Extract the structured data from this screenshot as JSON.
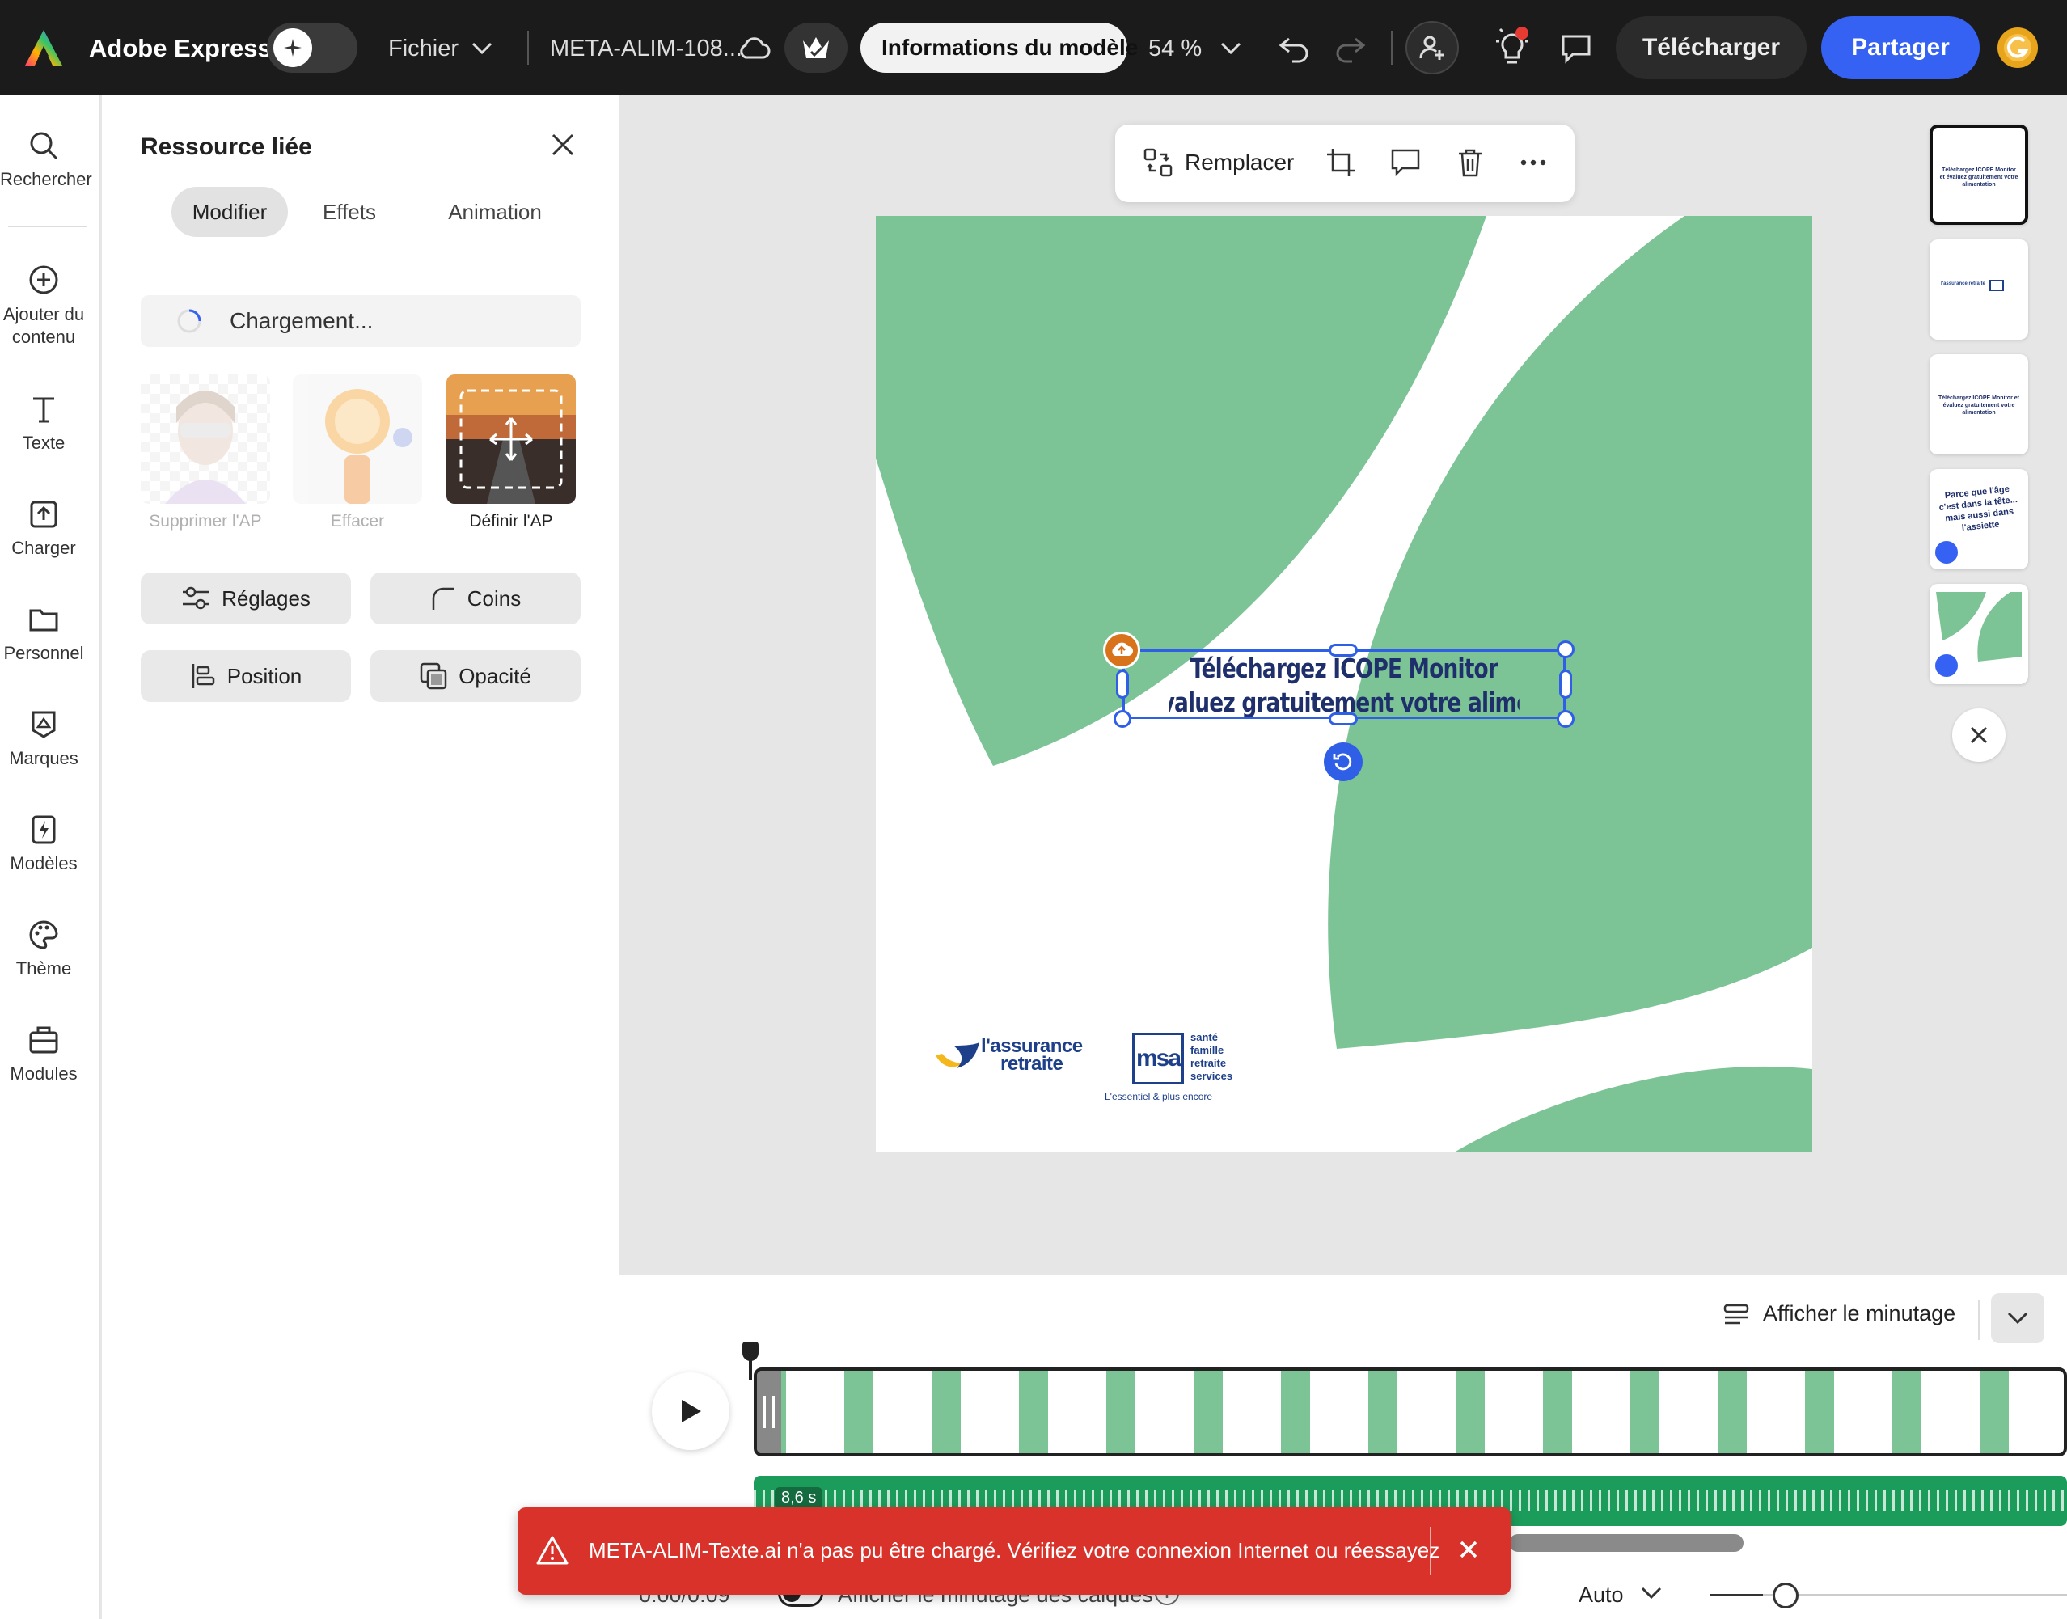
{
  "topbar": {
    "app_name": "Adobe Express",
    "file_menu": "Fichier",
    "doc_title": "META-ALIM-108...",
    "template_info": "Informations du modèle",
    "zoom": "54 %",
    "download": "Télécharger",
    "share": "Partager"
  },
  "rail": {
    "items": [
      {
        "label": "Rechercher",
        "icon": "search-icon"
      },
      {
        "label": "Ajouter du contenu",
        "icon": "plus-circle-icon"
      },
      {
        "label": "Texte",
        "icon": "text-icon"
      },
      {
        "label": "Charger",
        "icon": "upload-icon"
      },
      {
        "label": "Personnel",
        "icon": "folder-icon"
      },
      {
        "label": "Marques",
        "icon": "brand-icon"
      },
      {
        "label": "Modèles",
        "icon": "templates-icon"
      },
      {
        "label": "Thème",
        "icon": "palette-icon"
      },
      {
        "label": "Modules",
        "icon": "modules-icon"
      }
    ]
  },
  "panel": {
    "title": "Ressource liée",
    "tabs": [
      "Modifier",
      "Effets",
      "Animation"
    ],
    "loading": "Chargement...",
    "tools": [
      {
        "label": "Supprimer l'AP",
        "enabled": false
      },
      {
        "label": "Effacer",
        "enabled": false
      },
      {
        "label": "Définir l'AP",
        "enabled": true
      }
    ],
    "buttons": [
      "Réglages",
      "Coins",
      "Position",
      "Opacité"
    ]
  },
  "floatbar": {
    "replace": "Remplacer"
  },
  "canvas": {
    "text_line1": "Téléchargez ICOPE Monitor",
    "text_line2": "et évaluez gratuitement votre alimentation",
    "logo1_line1": "l'assurance",
    "logo1_line2": "retraite",
    "logo2_initials": "msa",
    "logo2_words": [
      "santé",
      "famille",
      "retraite",
      "services"
    ],
    "logo2_tagline": "L'essentiel & plus encore",
    "colors": {
      "green": "#7cc496",
      "navy": "#1e2f6b",
      "selection": "#2f5fe6"
    }
  },
  "thumbs": [
    {
      "text": "Téléchargez ICOPE Monitor et évaluez gratuitement votre alimentation"
    },
    {
      "text": "l'assurance retraite"
    },
    {
      "text": "Téléchargez ICOPE Monitor et évaluez gratuitement votre alimentation"
    },
    {
      "text": "Parce que l'âge c'est dans la tête... mais aussi dans l'assiette"
    },
    {
      "text": ""
    }
  ],
  "timeline": {
    "show_timing": "Afficher le minutage",
    "duration_badge": "8,6 s",
    "time": "0:00/0:09",
    "layers_timing": "Afficher le minutage des calques",
    "auto": "Auto"
  },
  "toast": {
    "message": "META-ALIM-Texte.ai n'a pas pu être chargé. Vérifiez votre connexion Internet ou réessayez"
  }
}
